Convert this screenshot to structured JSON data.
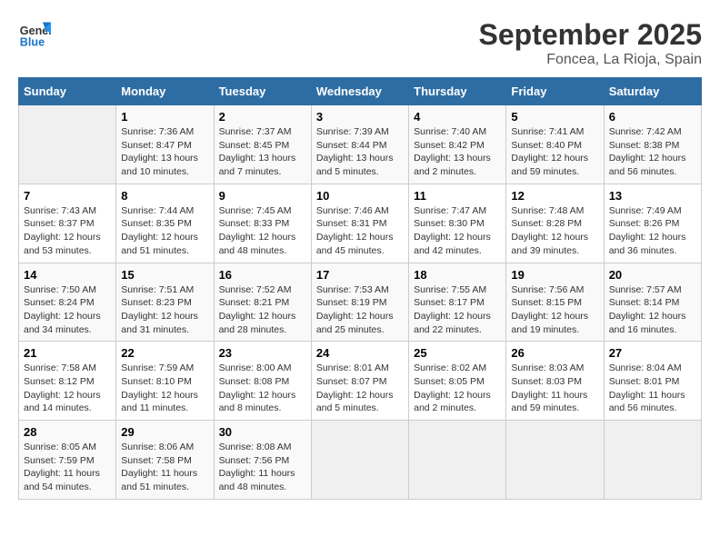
{
  "header": {
    "logo_general": "General",
    "logo_blue": "Blue",
    "title": "September 2025",
    "subtitle": "Foncea, La Rioja, Spain"
  },
  "days_of_week": [
    "Sunday",
    "Monday",
    "Tuesday",
    "Wednesday",
    "Thursday",
    "Friday",
    "Saturday"
  ],
  "weeks": [
    [
      {
        "day": "",
        "info": ""
      },
      {
        "day": "1",
        "info": "Sunrise: 7:36 AM\nSunset: 8:47 PM\nDaylight: 13 hours\nand 10 minutes."
      },
      {
        "day": "2",
        "info": "Sunrise: 7:37 AM\nSunset: 8:45 PM\nDaylight: 13 hours\nand 7 minutes."
      },
      {
        "day": "3",
        "info": "Sunrise: 7:39 AM\nSunset: 8:44 PM\nDaylight: 13 hours\nand 5 minutes."
      },
      {
        "day": "4",
        "info": "Sunrise: 7:40 AM\nSunset: 8:42 PM\nDaylight: 13 hours\nand 2 minutes."
      },
      {
        "day": "5",
        "info": "Sunrise: 7:41 AM\nSunset: 8:40 PM\nDaylight: 12 hours\nand 59 minutes."
      },
      {
        "day": "6",
        "info": "Sunrise: 7:42 AM\nSunset: 8:38 PM\nDaylight: 12 hours\nand 56 minutes."
      }
    ],
    [
      {
        "day": "7",
        "info": "Sunrise: 7:43 AM\nSunset: 8:37 PM\nDaylight: 12 hours\nand 53 minutes."
      },
      {
        "day": "8",
        "info": "Sunrise: 7:44 AM\nSunset: 8:35 PM\nDaylight: 12 hours\nand 51 minutes."
      },
      {
        "day": "9",
        "info": "Sunrise: 7:45 AM\nSunset: 8:33 PM\nDaylight: 12 hours\nand 48 minutes."
      },
      {
        "day": "10",
        "info": "Sunrise: 7:46 AM\nSunset: 8:31 PM\nDaylight: 12 hours\nand 45 minutes."
      },
      {
        "day": "11",
        "info": "Sunrise: 7:47 AM\nSunset: 8:30 PM\nDaylight: 12 hours\nand 42 minutes."
      },
      {
        "day": "12",
        "info": "Sunrise: 7:48 AM\nSunset: 8:28 PM\nDaylight: 12 hours\nand 39 minutes."
      },
      {
        "day": "13",
        "info": "Sunrise: 7:49 AM\nSunset: 8:26 PM\nDaylight: 12 hours\nand 36 minutes."
      }
    ],
    [
      {
        "day": "14",
        "info": "Sunrise: 7:50 AM\nSunset: 8:24 PM\nDaylight: 12 hours\nand 34 minutes."
      },
      {
        "day": "15",
        "info": "Sunrise: 7:51 AM\nSunset: 8:23 PM\nDaylight: 12 hours\nand 31 minutes."
      },
      {
        "day": "16",
        "info": "Sunrise: 7:52 AM\nSunset: 8:21 PM\nDaylight: 12 hours\nand 28 minutes."
      },
      {
        "day": "17",
        "info": "Sunrise: 7:53 AM\nSunset: 8:19 PM\nDaylight: 12 hours\nand 25 minutes."
      },
      {
        "day": "18",
        "info": "Sunrise: 7:55 AM\nSunset: 8:17 PM\nDaylight: 12 hours\nand 22 minutes."
      },
      {
        "day": "19",
        "info": "Sunrise: 7:56 AM\nSunset: 8:15 PM\nDaylight: 12 hours\nand 19 minutes."
      },
      {
        "day": "20",
        "info": "Sunrise: 7:57 AM\nSunset: 8:14 PM\nDaylight: 12 hours\nand 16 minutes."
      }
    ],
    [
      {
        "day": "21",
        "info": "Sunrise: 7:58 AM\nSunset: 8:12 PM\nDaylight: 12 hours\nand 14 minutes."
      },
      {
        "day": "22",
        "info": "Sunrise: 7:59 AM\nSunset: 8:10 PM\nDaylight: 12 hours\nand 11 minutes."
      },
      {
        "day": "23",
        "info": "Sunrise: 8:00 AM\nSunset: 8:08 PM\nDaylight: 12 hours\nand 8 minutes."
      },
      {
        "day": "24",
        "info": "Sunrise: 8:01 AM\nSunset: 8:07 PM\nDaylight: 12 hours\nand 5 minutes."
      },
      {
        "day": "25",
        "info": "Sunrise: 8:02 AM\nSunset: 8:05 PM\nDaylight: 12 hours\nand 2 minutes."
      },
      {
        "day": "26",
        "info": "Sunrise: 8:03 AM\nSunset: 8:03 PM\nDaylight: 11 hours\nand 59 minutes."
      },
      {
        "day": "27",
        "info": "Sunrise: 8:04 AM\nSunset: 8:01 PM\nDaylight: 11 hours\nand 56 minutes."
      }
    ],
    [
      {
        "day": "28",
        "info": "Sunrise: 8:05 AM\nSunset: 7:59 PM\nDaylight: 11 hours\nand 54 minutes."
      },
      {
        "day": "29",
        "info": "Sunrise: 8:06 AM\nSunset: 7:58 PM\nDaylight: 11 hours\nand 51 minutes."
      },
      {
        "day": "30",
        "info": "Sunrise: 8:08 AM\nSunset: 7:56 PM\nDaylight: 11 hours\nand 48 minutes."
      },
      {
        "day": "",
        "info": ""
      },
      {
        "day": "",
        "info": ""
      },
      {
        "day": "",
        "info": ""
      },
      {
        "day": "",
        "info": ""
      }
    ]
  ]
}
